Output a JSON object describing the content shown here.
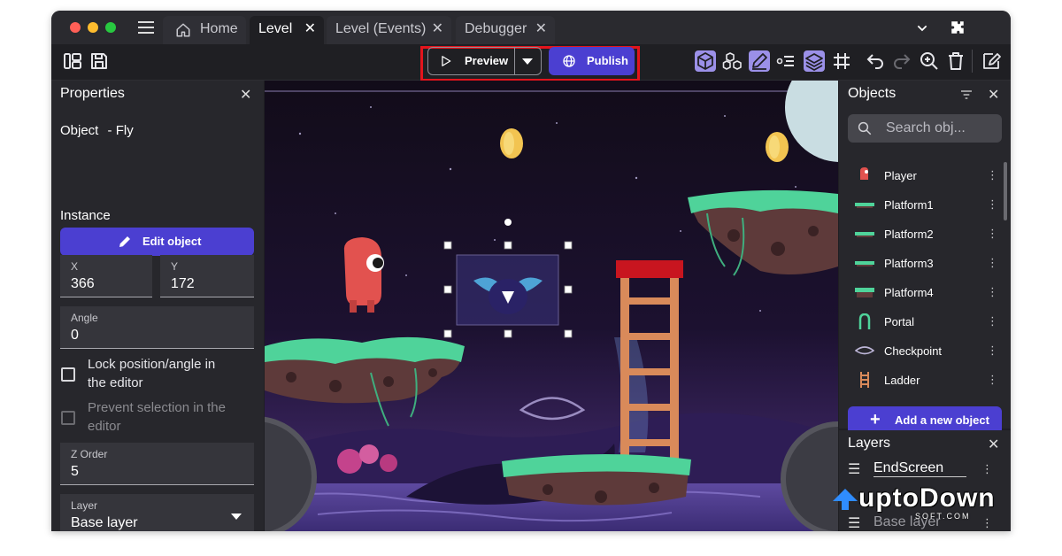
{
  "colors": {
    "accent": "#4b3fd1",
    "highlight": "#e3141c",
    "mac_close": "#ff5f57",
    "mac_min": "#febc2e",
    "mac_max": "#28c840"
  },
  "tabs": [
    {
      "label": "Home",
      "icon": "home-icon"
    },
    {
      "label": "Level",
      "active": true
    },
    {
      "label": "Level (Events)"
    },
    {
      "label": "Debugger"
    }
  ],
  "toolbar": {
    "preview_label": "Preview",
    "publish_label": "Publish"
  },
  "properties": {
    "title": "Properties",
    "object_prefix": "Object",
    "object_name": "- Fly",
    "edit_object_label": "Edit object",
    "instance_heading": "Instance",
    "x_label": "X",
    "x_value": "366",
    "y_label": "Y",
    "y_value": "172",
    "angle_label": "Angle",
    "angle_value": "0",
    "lock_label_1": "Lock position/angle in",
    "lock_label_2": "the editor",
    "prevent_label_1": "Prevent selection in the",
    "prevent_label_2": "editor",
    "zorder_label": "Z Order",
    "zorder_value": "5",
    "layer_label": "Layer",
    "layer_value": "Base layer"
  },
  "objects": {
    "title": "Objects",
    "search_placeholder": "Search obj...",
    "items": [
      {
        "label": "Player",
        "icon": "player-icon"
      },
      {
        "label": "Platform1",
        "icon": "platform-icon"
      },
      {
        "label": "Platform2",
        "icon": "platform-icon"
      },
      {
        "label": "Platform3",
        "icon": "platform-icon"
      },
      {
        "label": "Platform4",
        "icon": "platform-icon"
      },
      {
        "label": "Portal",
        "icon": "portal-icon"
      },
      {
        "label": "Checkpoint",
        "icon": "checkpoint-icon"
      },
      {
        "label": "Ladder",
        "icon": "ladder-icon"
      }
    ],
    "add_label": "Add a new object"
  },
  "layers": {
    "title": "Layers",
    "items": [
      {
        "label": "EndScreen"
      },
      {
        "label": "Base layer"
      }
    ]
  },
  "watermark": {
    "brand": "uptoDown",
    "sub": "SOFT.COM"
  }
}
